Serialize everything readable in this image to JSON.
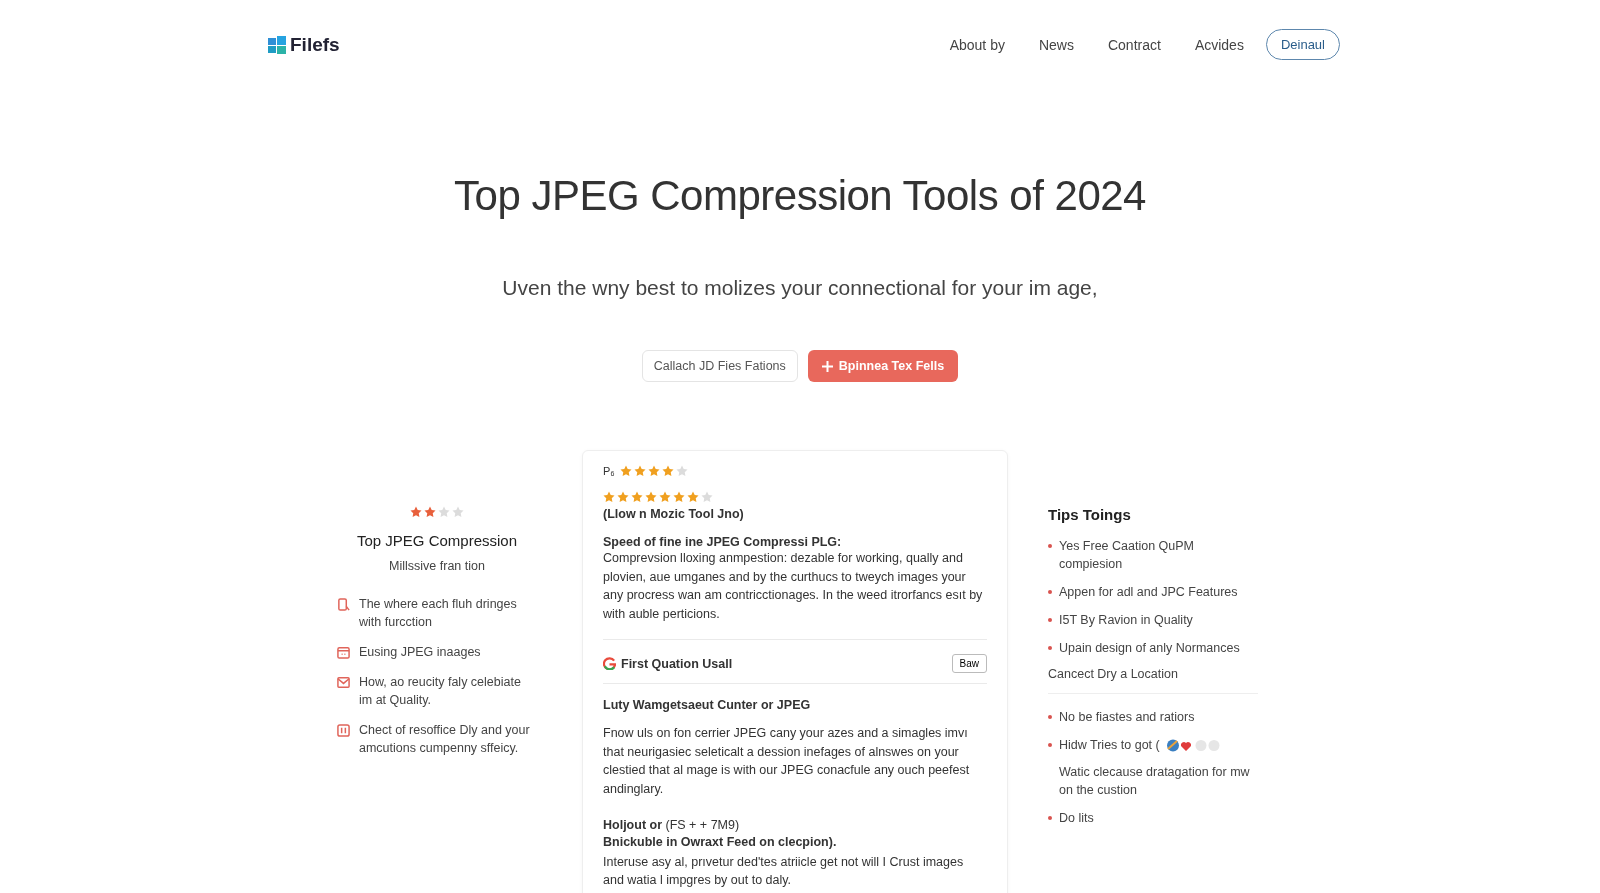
{
  "header": {
    "logo": "Filefs",
    "nav": [
      "About by",
      "News",
      "Contract",
      "Acvides"
    ],
    "cta": "Deinaul"
  },
  "hero": {
    "title": "Top JPEG Compression Tools of 2024",
    "subtitle": "Uven the wny best to molizes your connectional for your im age,",
    "secondary_button": "Callach JD Fies Fations",
    "primary_button": "Bpinnea Tex Fells"
  },
  "left": {
    "stars": 2,
    "title": "Top JPEG Compression",
    "subtitle": "Millssive fran tion",
    "features": [
      {
        "kind": "phone",
        "text": "The where each fluh dringes with furcction"
      },
      {
        "kind": "calendar",
        "text": "Eusing JPEG inaages"
      },
      {
        "kind": "mail",
        "text": "How, ao reucity faly celebiate im at Quality."
      },
      {
        "kind": "pause",
        "text": "Chect of resoffice Dly and your amcutions cumpenny sffeicy."
      }
    ]
  },
  "card": {
    "label": "P₆",
    "rating_1": {
      "stars": 4
    },
    "rating_2": {
      "stars": 7
    },
    "heading": "(Llow n Mozic Tool Jno)",
    "section_title": "Speed of fine ine JPEG Compressi PLG:",
    "section_text": "Comprevsion lloxing anmpestion: dezable for working, qually and plovien, aue umganes and by the curthucs to tweych images your any procress wan am contricctionages. In the weed itrorfancs esıt by with auble perticions.",
    "source": {
      "name": "First Quation Usall",
      "button": "Baw"
    },
    "subheading": "Luty Wamgetsaeut Cunter or JPEG",
    "body": "Fnow uls on fon cerrier JPEG cany your azes and a simagles imvı that neurigasiec seleticalt a dession inefages of alnswes on your clestied that al mage is with our JPEG conacfule any ouch peefest andinglary.",
    "note_line": "**Holjout or** (FS + + 7M9)",
    "note_bold": "Bnickuble in Owraxt Feed on clecpion).",
    "footer_text": "Interuse asy al, prıvetur ded'tes atriicle get not will I Crust images and watia l impgres by out to daly."
  },
  "right": {
    "title": "Tips Toings",
    "items": [
      {
        "kind": "bullet",
        "text": "Yes Free Caation QuPM compiesion"
      },
      {
        "kind": "bullet",
        "text": "Appen for adl and JPC Features"
      },
      {
        "kind": "bullet",
        "text": "I5T By Ravion in Quality"
      },
      {
        "kind": "bullet",
        "text": "Upain design of anly Normances"
      },
      {
        "kind": "heading",
        "text": "Cancect Dry a Location"
      },
      {
        "kind": "bullet",
        "text": "No be fiastes and ratiors"
      },
      {
        "kind": "bullet-icons",
        "text": "Hidw Tries to got ("
      },
      {
        "kind": "note",
        "text": "Watic clecause dratagation for mw on the custion"
      },
      {
        "kind": "bullet",
        "text": "Do lits"
      }
    ]
  }
}
